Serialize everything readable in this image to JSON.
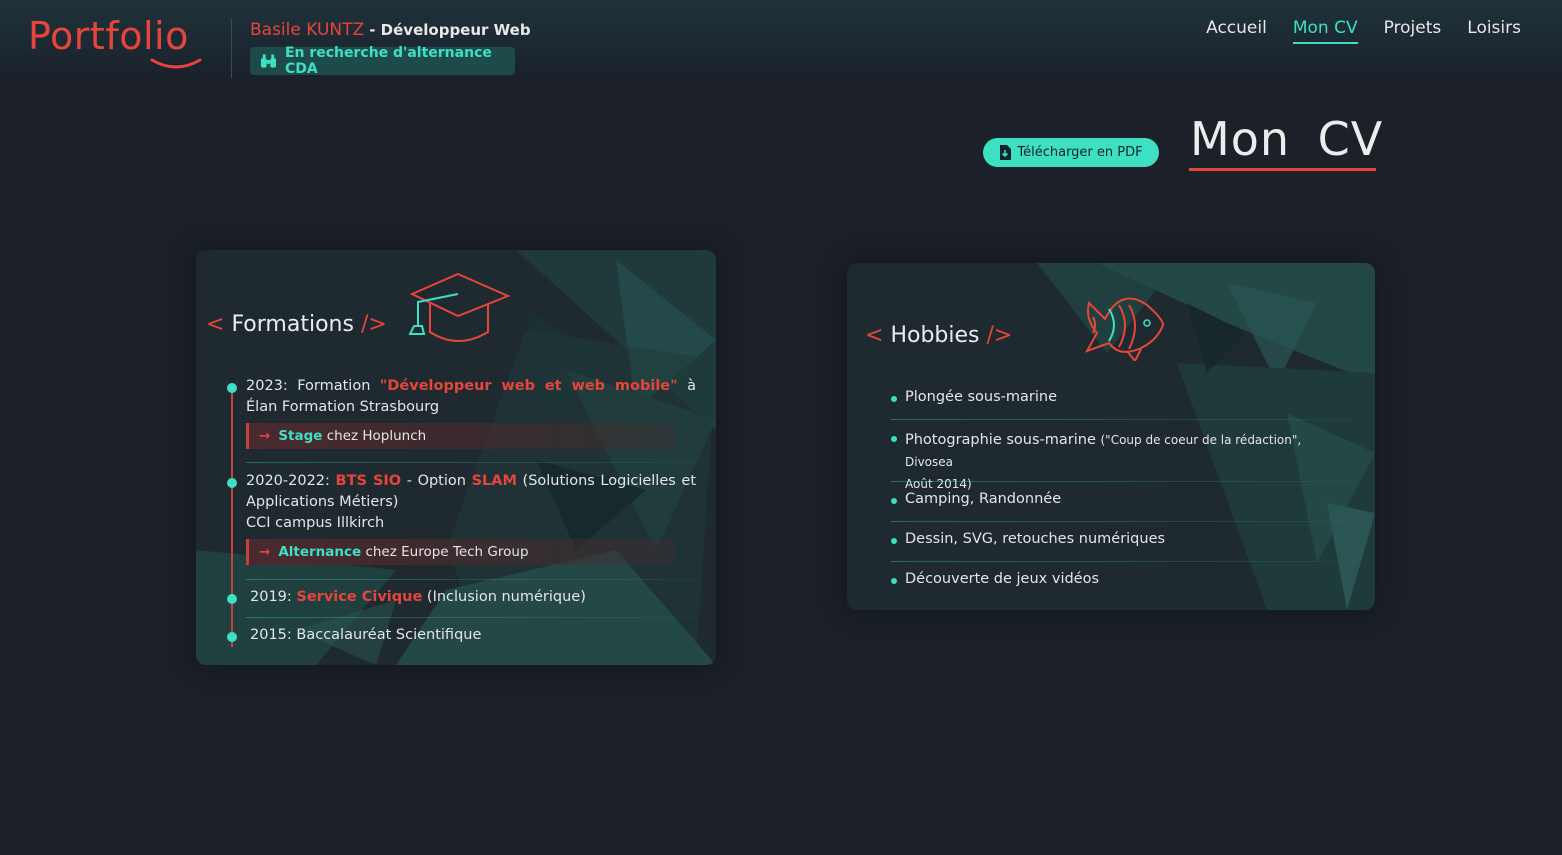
{
  "header": {
    "logo": "Portfolio",
    "name": "Basile KUNTZ",
    "role": "- Développeur Web",
    "badge": "En recherche d'alternance CDA",
    "nav": [
      {
        "label": "Accueil",
        "active": false
      },
      {
        "label": "Mon CV",
        "active": true
      },
      {
        "label": "Projets",
        "active": false
      },
      {
        "label": "Loisirs",
        "active": false
      }
    ]
  },
  "page": {
    "pdf_button": "Télécharger en PDF",
    "title": "Mon CV"
  },
  "formations": {
    "title_open": "<",
    "title": "Formations",
    "title_close": "/>",
    "items": [
      {
        "year": "2023: Formation",
        "highlight": "\"Développeur web et web mobile\"",
        "rest": "à Élan Formation Strasbourg",
        "sub_highlight": "Stage",
        "sub_rest": "chez Hoplunch"
      },
      {
        "year": "2020-2022:",
        "highlight": "BTS SIO",
        "mid": "- Option",
        "highlight2": "SLAM",
        "rest": "(Solutions Logicielles et Applications Métiers)",
        "line2": "CCI campus Illkirch",
        "sub_highlight": "Alternance",
        "sub_rest": "chez Europe Tech Group"
      },
      {
        "year": "2019:",
        "highlight": "Service Civique",
        "rest": "(Inclusion numérique)"
      },
      {
        "text": "2015: Baccalauréat Scientifique"
      }
    ]
  },
  "hobbies": {
    "title_open": "<",
    "title": "Hobbies",
    "title_close": "/>",
    "items": [
      {
        "label": "Plongée sous-marine",
        "note": ""
      },
      {
        "label": "Photographie sous-marine",
        "note": "(\"Coup de coeur de la rédaction\", Divosea",
        "note2": "Août 2014)"
      },
      {
        "label": "Camping, Randonnée",
        "note": ""
      },
      {
        "label": "Dessin, SVG, retouches numériques",
        "note": ""
      },
      {
        "label": "Découverte de jeux vidéos",
        "note": ""
      }
    ]
  },
  "colors": {
    "accent_red": "#e5453b",
    "accent_teal": "#3ee0c4",
    "background": "#1b2029"
  }
}
